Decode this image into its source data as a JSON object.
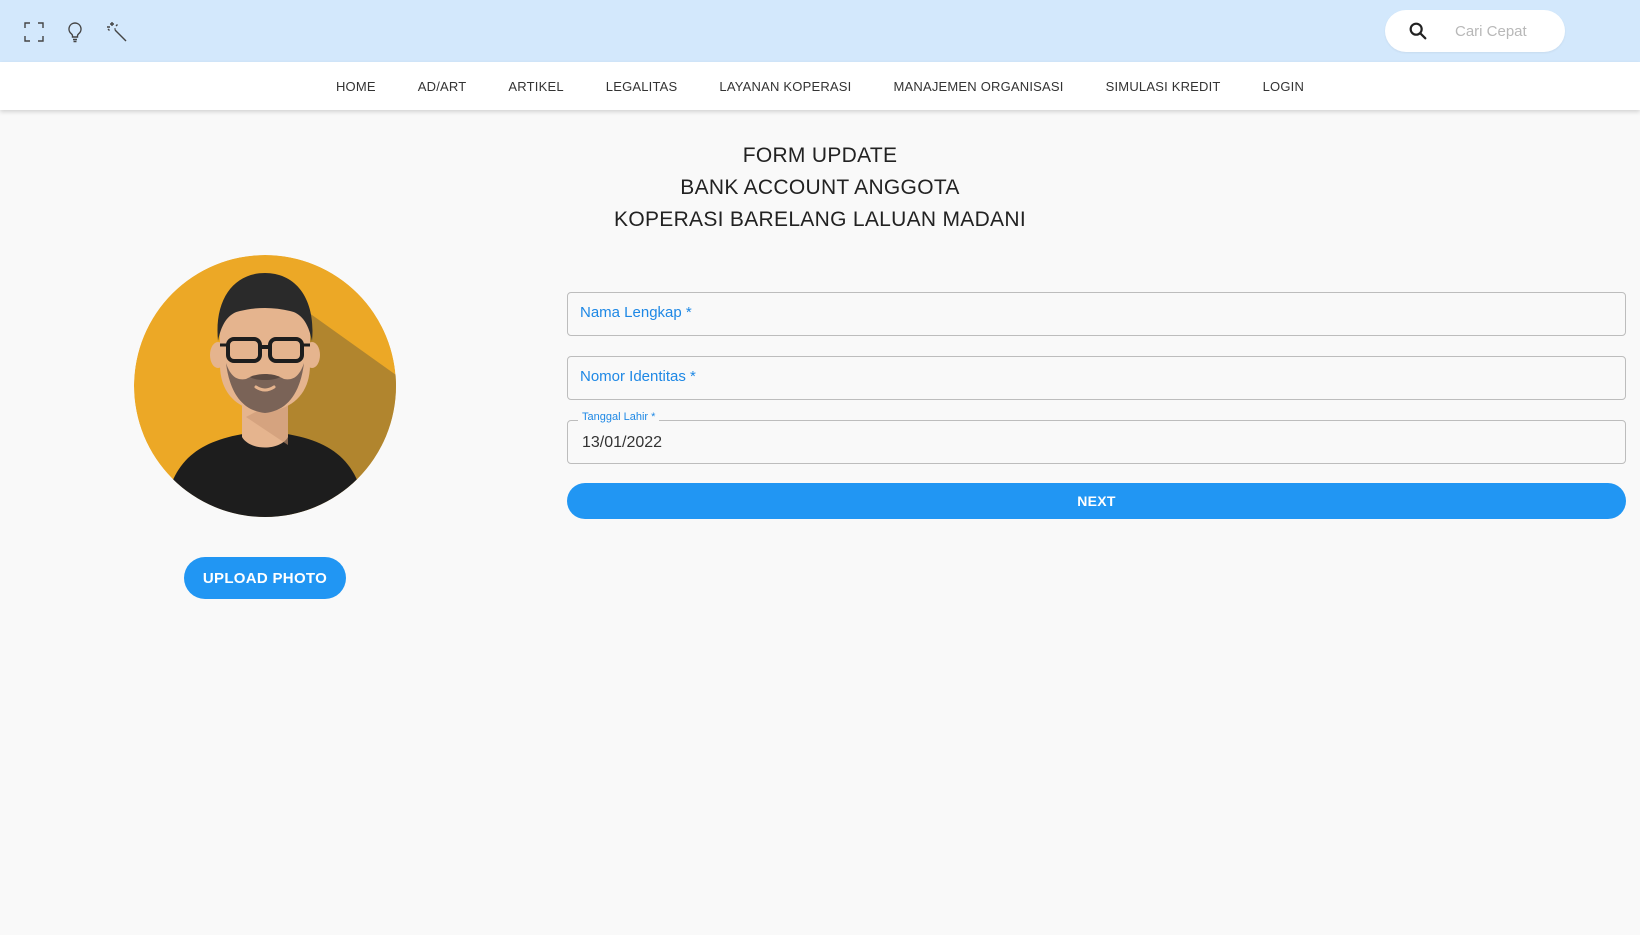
{
  "toolbar": {
    "icons": [
      "fullscreen-icon",
      "lightbulb-icon",
      "magic-wand-icon"
    ],
    "search_placeholder": "Cari Cepat"
  },
  "nav": {
    "items": [
      {
        "label": "HOME"
      },
      {
        "label": "AD/ART"
      },
      {
        "label": "ARTIKEL"
      },
      {
        "label": "LEGALITAS"
      },
      {
        "label": "LAYANAN KOPERASI"
      },
      {
        "label": "MANAJEMEN ORGANISASI"
      },
      {
        "label": "SIMULASI KREDIT"
      },
      {
        "label": "LOGIN"
      }
    ]
  },
  "form": {
    "title_lines": [
      "FORM UPDATE",
      "BANK ACCOUNT ANGGOTA",
      "KOPERASI BARELANG LALUAN MADANI"
    ],
    "fields": {
      "nama_lengkap": {
        "label": "Nama Lengkap *",
        "value": ""
      },
      "nomor_identitas": {
        "label": "Nomor Identitas *",
        "value": ""
      },
      "tanggal_lahir": {
        "label": "Tanggal Lahir *",
        "value": "13/01/2022"
      }
    },
    "next_label": "NEXT"
  },
  "profile": {
    "avatar": "avatar-placeholder-man-glasses-beard",
    "upload_label": "UPLOAD PHOTO"
  },
  "colors": {
    "topbar_bg": "#d3e8fc",
    "primary": "#2196f3",
    "label_blue": "#1e88e5",
    "avatar_bg": "#eca826"
  }
}
